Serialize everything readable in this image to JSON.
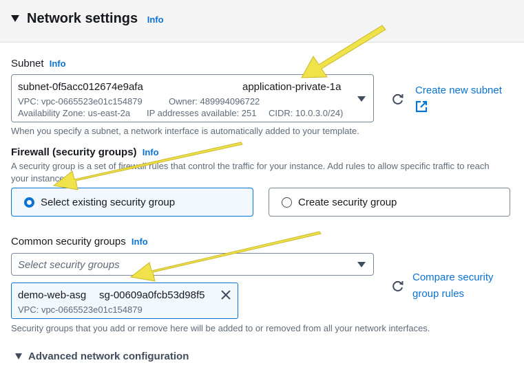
{
  "header": {
    "title": "Network settings",
    "info": "Info"
  },
  "subnet": {
    "label": "Subnet",
    "info": "Info",
    "id": "subnet-0f5acc012674e9afa",
    "name": "application-private-1a",
    "vpc": "VPC: vpc-0665523e01c154879",
    "owner": "Owner: 489994096722",
    "az": "Availability Zone: us-east-2a",
    "ips": "IP addresses available: 251",
    "cidr": "CIDR: 10.0.3.0/24)",
    "create_link": "Create new subnet",
    "description": "When you specify a subnet, a network interface is automatically added to your template."
  },
  "firewall": {
    "label": "Firewall (security groups)",
    "info": "Info",
    "description": "A security group is a set of firewall rules that control the traffic for your instance. Add rules to allow specific traffic to reach your instance.",
    "options": [
      {
        "label": "Select existing security group",
        "selected": true
      },
      {
        "label": "Create security group",
        "selected": false
      }
    ]
  },
  "common_sg": {
    "label": "Common security groups",
    "info": "Info",
    "placeholder": "Select security groups",
    "compare_link_line1": "Compare security",
    "compare_link_line2": "group rules",
    "token": {
      "name": "demo-web-asg",
      "id": "sg-00609a0fcb53d98f5",
      "vpc": "VPC: vpc-0665523e01c154879"
    },
    "description": "Security groups that you add or remove here will be added to or removed from all your network interfaces."
  },
  "advanced": {
    "label": "Advanced network configuration"
  },
  "colors": {
    "link": "#0972d3",
    "arrow": "#f0e24a",
    "selected_bg": "#f2f8fd"
  },
  "icons": [
    "refresh-icon",
    "external-link-icon",
    "close-icon",
    "caret-down-icon",
    "expand-triangle-icon"
  ]
}
